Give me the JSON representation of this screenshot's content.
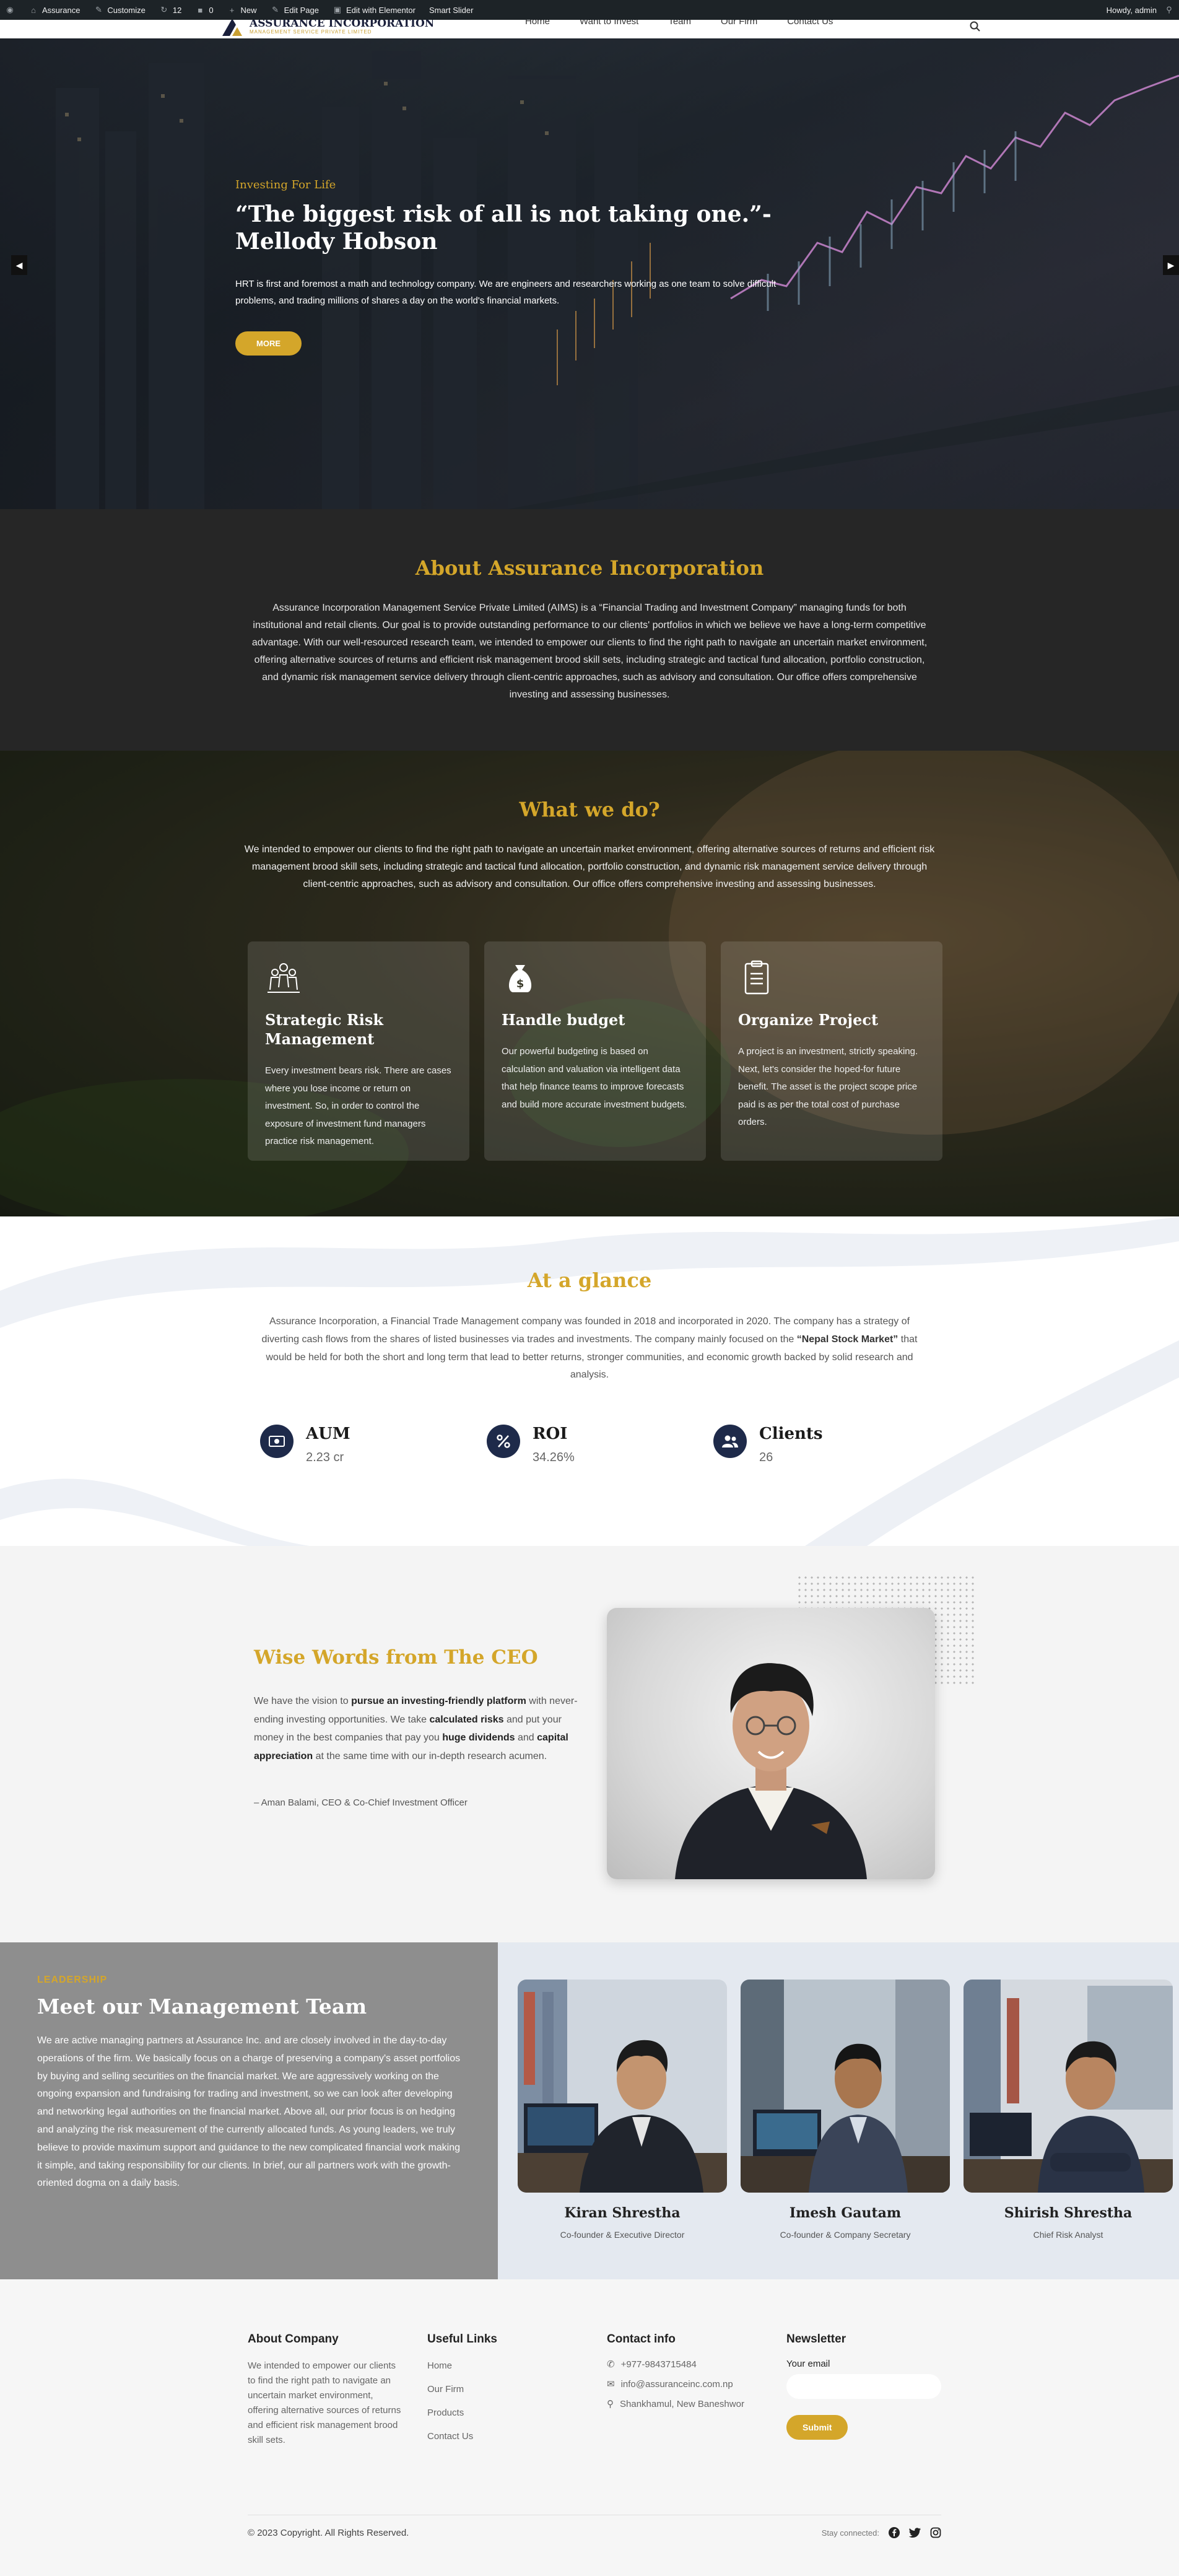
{
  "adminbar": {
    "site_name": "Assurance",
    "customize": "Customize",
    "updates": "12",
    "comments": "0",
    "new": "New",
    "edit_page": "Edit Page",
    "elementor": "Edit with Elementor",
    "smart_slider": "Smart Slider",
    "howdy": "Howdy, admin"
  },
  "header": {
    "logo_title": "ASSURANCE INCORPORATION",
    "logo_sub": "MANAGEMENT SERVICE PRIVATE LIMITED",
    "nav": [
      "Home",
      "Want to Invest",
      "Team",
      "Our Firm",
      "Contact Us"
    ]
  },
  "hero": {
    "kicker": "Investing For Life",
    "title": "“The biggest risk of all is not taking one.”- Mellody Hobson",
    "text": "HRT is first and foremost a math and technology company. We are engineers and researchers working as one team to solve difficult problems, and trading millions of shares a day on the world's financial markets.",
    "button": "MORE"
  },
  "about": {
    "title": "About Assurance Incorporation",
    "text": "Assurance Incorporation Management Service Private Limited (AIMS) is a “Financial Trading and Investment Company” managing funds for both institutional and retail clients. Our goal is to provide outstanding performance to our clients' portfolios in which we believe we have a long-term competitive advantage. With our well-resourced research team, we intended to empower our clients to find the right path to navigate an uncertain market environment, offering alternative sources of returns and efficient risk management brood skill sets, including strategic and tactical fund allocation, portfolio construction, and dynamic risk management service delivery through client-centric approaches, such as advisory and consultation. Our office offers comprehensive investing and assessing businesses."
  },
  "whatwedo": {
    "title": "What we do?",
    "text": "We intended to empower our clients to find the right path to navigate an uncertain market environment, offering alternative sources of returns and efficient risk management brood skill sets, including strategic and tactical fund allocation, portfolio construction, and dynamic risk management service delivery through client-centric approaches, such as advisory and consultation. Our office offers comprehensive investing and assessing businesses.",
    "cards": [
      {
        "icon": "team-icon",
        "title": "Strategic Risk Management",
        "text": "Every investment bears risk. There are cases where you lose income or return on investment. So, in order to  control the exposure of investment fund managers practice risk management."
      },
      {
        "icon": "money-bag-icon",
        "title": "Handle budget",
        "text": "Our powerful budgeting is based on calculation and valuation via intelligent data that help finance teams to improve forecasts and build more accurate investment budgets."
      },
      {
        "icon": "clipboard-icon",
        "title": "Organize Project",
        "text": "A project is an investment, strictly speaking. Next, let's consider the hoped-for future benefit. The asset is the project scope  price paid is as per the total cost of purchase orders."
      }
    ]
  },
  "glance": {
    "title": "At a glance",
    "text_1": "Assurance Incorporation, a Financial Trade Management company was founded in 2018 and incorporated in 2020. The company has a strategy of diverting cash flows from the shares of listed businesses via trades and investments. The company mainly focused on the ",
    "text_bold": "“Nepal Stock Market”",
    "text_2": " that would be held for both the short and long term that lead to better returns, stronger communities, and economic growth backed by solid research and analysis.",
    "stats": [
      {
        "label": "AUM",
        "value": "2.23 cr",
        "icon": "cash-icon"
      },
      {
        "label": "ROI",
        "value": "34.26%",
        "icon": "percent-icon"
      },
      {
        "label": "Clients",
        "value": "26",
        "icon": "users-icon"
      }
    ]
  },
  "ceo": {
    "title": "Wise Words from The CEO",
    "p1": "We have the vision to ",
    "b1": "pursue an investing-friendly platform",
    "p2": " with never-ending investing opportunities. We take ",
    "b2": "calculated risks",
    "p3": " and put your money in the best companies that pay you ",
    "b3": "huge dividends",
    "p4": " and ",
    "b4": "capital appreciation",
    "p5": " at the same time with our in-depth research acumen.",
    "signature": "– Aman Balami, CEO & Co-Chief Investment Officer"
  },
  "team": {
    "kicker": "LEADERSHIP",
    "title": "Meet our Management Team",
    "text": "We are active managing partners at Assurance Inc. and are closely involved in the day-to-day operations of the firm. We basically focus on a charge of preserving a company's asset portfolios by buying and selling securities on the financial market. We are aggressively working on the ongoing expansion and fundraising for trading and investment, so we can look after developing and networking legal authorities on the financial market. Above all, our prior focus is on hedging and analyzing the risk measurement of the currently allocated funds. As young leaders, we truly believe to provide maximum support and guidance to the new complicated financial work making it simple, and taking responsibility for our clients. In brief, our all partners work with the growth-oriented dogma on a daily basis.",
    "members": [
      {
        "name": "Kiran Shrestha",
        "role": "Co-founder & Executive Director"
      },
      {
        "name": "Imesh Gautam",
        "role": "Co-founder & Company Secretary"
      },
      {
        "name": "Shirish Shrestha",
        "role": "Chief Risk Analyst"
      }
    ]
  },
  "footer": {
    "about_title": "About Company",
    "about_text": "We intended to empower our clients to find the right path to navigate an uncertain market environment, offering alternative sources of returns and efficient risk management brood skill sets.",
    "links_title": "Useful Links",
    "links": [
      "Home",
      "Our Firm",
      "Products",
      "Contact Us"
    ],
    "contact_title": "Contact info",
    "phone": "+977-9843715484",
    "email": "info@assuranceinc.com.np",
    "address": "Shankhamul, New Baneshwor",
    "newsletter_title": "Newsletter",
    "email_label": "Your email",
    "submit": "Submit",
    "copyright": "© 2023 Copyright. All Rights Reserved.",
    "stay_connected": "Stay connected:"
  },
  "colors": {
    "gold": "#d4a62a",
    "navy": "#1e2a4a",
    "dark": "#262626"
  }
}
